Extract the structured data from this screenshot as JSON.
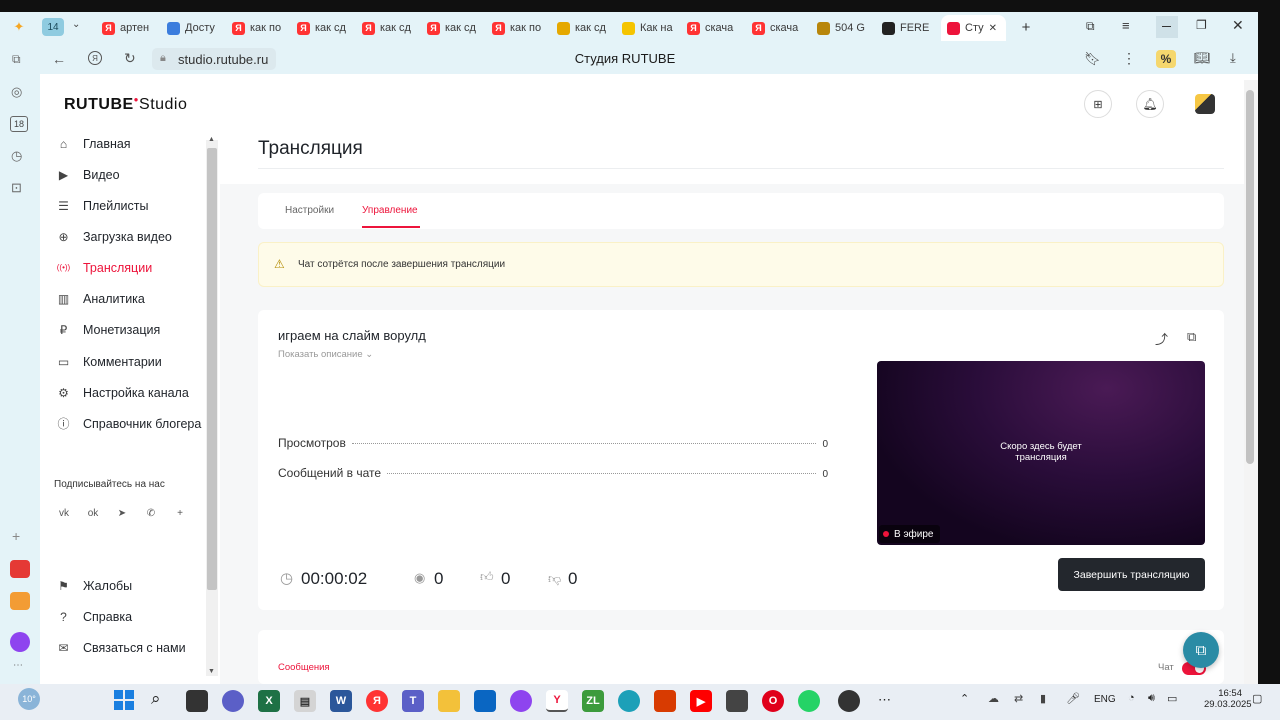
{
  "browser": {
    "tab_counter": "14",
    "tabs": [
      {
        "label": "артен",
        "icon": "yandex-icon",
        "color": "#f33"
      },
      {
        "label": "Досту",
        "icon": "app-icon",
        "color": "#3b7ddd"
      },
      {
        "label": "как по",
        "icon": "yandex-icon",
        "color": "#f33"
      },
      {
        "label": "как сд",
        "icon": "yandex-icon",
        "color": "#f33"
      },
      {
        "label": "как сд",
        "icon": "yandex-icon",
        "color": "#f33"
      },
      {
        "label": "как сд",
        "icon": "yandex-icon",
        "color": "#f33"
      },
      {
        "label": "как по",
        "icon": "yandex-icon",
        "color": "#f33"
      },
      {
        "label": "как сд",
        "icon": "image-icon",
        "color": "#e5a800"
      },
      {
        "label": "Как на",
        "icon": "play-icon",
        "color": "#f5c400"
      },
      {
        "label": "скача",
        "icon": "yandex-icon",
        "color": "#f33"
      },
      {
        "label": "скача",
        "icon": "yandex-icon",
        "color": "#f33"
      },
      {
        "label": "504 G",
        "icon": "game-icon",
        "color": "#b8860b"
      },
      {
        "label": "FERE",
        "icon": "rutube-icon",
        "color": "#222"
      },
      {
        "label": "Сту",
        "icon": "rutube-studio-icon",
        "color": "#ed143b"
      }
    ],
    "url": "studio.rutube.ru",
    "page_title": "Студия RUTUBE"
  },
  "studio": {
    "logo": "RUTUBE",
    "logo_suffix": "Studio",
    "nav": [
      {
        "label": "Главная",
        "icon": "home-icon"
      },
      {
        "label": "Видео",
        "icon": "video-icon"
      },
      {
        "label": "Плейлисты",
        "icon": "playlist-icon"
      },
      {
        "label": "Загрузка видео",
        "icon": "upload-icon"
      },
      {
        "label": "Трансляции",
        "icon": "broadcast-icon",
        "active": true
      },
      {
        "label": "Аналитика",
        "icon": "analytics-icon"
      },
      {
        "label": "Монетизация",
        "icon": "ruble-icon"
      },
      {
        "label": "Комментарии",
        "icon": "comment-icon"
      },
      {
        "label": "Настройка канала",
        "icon": "gear-icon"
      },
      {
        "label": "Справочник блогера",
        "icon": "info-icon"
      }
    ],
    "follow_us": "Подписывайтесь на нас",
    "social": [
      "vk-icon",
      "ok-icon",
      "telegram-icon",
      "viber-icon",
      "plus-icon"
    ],
    "bottom_nav": [
      {
        "label": "Жалобы",
        "icon": "flag-icon"
      },
      {
        "label": "Справка",
        "icon": "help-icon"
      },
      {
        "label": "Связаться с нами",
        "icon": "mail-icon"
      }
    ],
    "page_heading": "Трансляция",
    "tabs": [
      "Настройки",
      "Управление"
    ],
    "active_tab": "Управление",
    "warning": "Чат сотрётся после завершения трансляции",
    "stream": {
      "title": "играем на слайм ворулд",
      "show_description": "Показать описание",
      "stats": [
        {
          "label": "Просмотров",
          "value": "0"
        },
        {
          "label": "Сообщений в чате",
          "value": "0"
        }
      ],
      "timer": "00:00:02",
      "viewers": "0",
      "likes": "0",
      "dislikes": "0",
      "preview_text_1": "Скоро здесь будет",
      "preview_text_2": "трансляция",
      "live_badge": "В эфире",
      "end_button": "Завершить трансляцию"
    },
    "messages_label": "Сообщения",
    "chat_label": "Чат",
    "chat_toggle_on": true
  },
  "colors": {
    "accent": "#ed143b",
    "dark_button": "#23272d",
    "warning_bg": "#fefbe9",
    "fab": "#2a8ba5"
  },
  "taskbar": {
    "lang": "ENG",
    "time": "16:54",
    "date": "29.03.2025",
    "weather": "10°"
  }
}
